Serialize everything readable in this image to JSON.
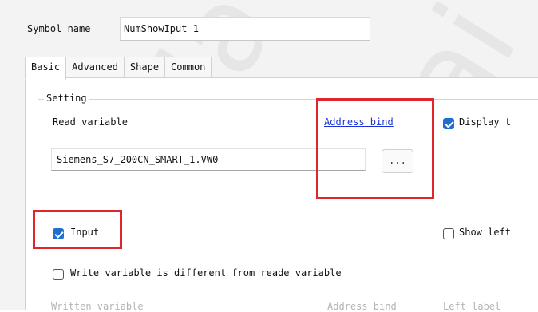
{
  "symbol_name": {
    "label": "Symbol name",
    "value": "NumShowIput_1"
  },
  "tabs": [
    {
      "label": "Basic",
      "active": true
    },
    {
      "label": "Advanced",
      "active": false
    },
    {
      "label": "Shape",
      "active": false
    },
    {
      "label": "Common",
      "active": false
    }
  ],
  "setting": {
    "title": "Setting",
    "read_variable_label": "Read variable",
    "address_bind_label": "Address bind",
    "display_checkbox_label": "Display t",
    "display_checked": true,
    "read_variable_value": "Siemens_S7_200CN_SMART_1.VW0",
    "browse_label": "...",
    "input_label": "Input",
    "input_checked": true,
    "show_left_label": "Show left",
    "show_left_checked": false,
    "write_different_label": "Write variable is different from reade variable",
    "write_different_checked": false,
    "written_variable_label": "Written variable",
    "written_address_bind_label": "Address bind",
    "left_label_label": "Left label"
  },
  "watermark": {
    "text_a": "Ha",
    "text_b": "Hai"
  },
  "colors": {
    "highlight": "#e0262b",
    "check": "#1f6fd1",
    "link": "#1a31d8"
  }
}
